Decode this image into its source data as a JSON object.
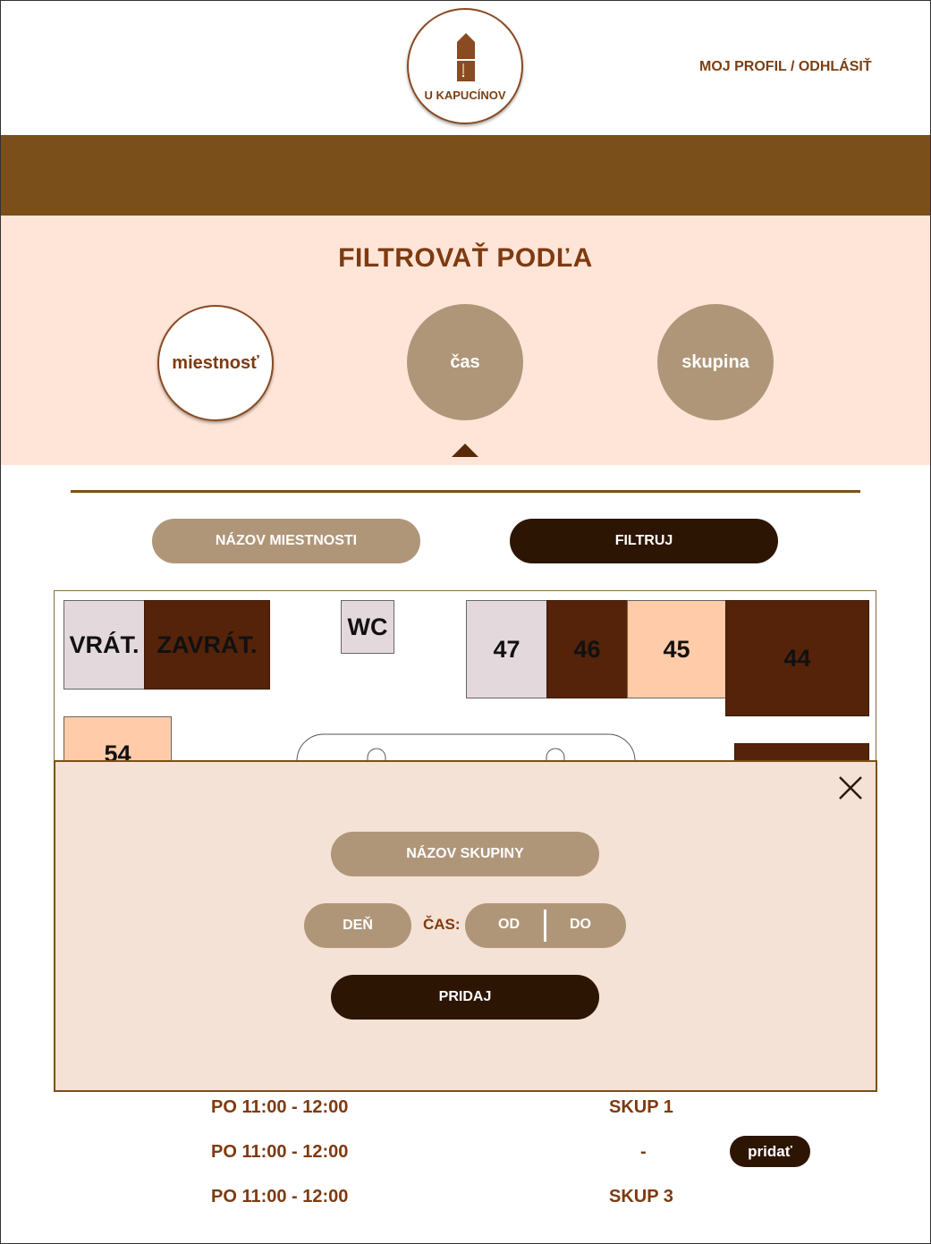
{
  "header": {
    "logo_text": "U KAPUCÍNOV",
    "profile_link": "MOJ PROFIL / ODHLÁSIŤ"
  },
  "filter": {
    "title": "FILTROVAŤ PODĽA",
    "options": [
      {
        "label": "miestnosť",
        "active": true
      },
      {
        "label": "čas",
        "active": false
      },
      {
        "label": "skupina",
        "active": false
      }
    ]
  },
  "controls": {
    "room_name": "NÁZOV MIESTNOSTI",
    "filter_button": "FILTRUJ"
  },
  "map": {
    "rooms": [
      {
        "label": "VRÁT.",
        "style": "grey"
      },
      {
        "label": "ZAVRÁT.",
        "style": "dark"
      },
      {
        "label": "WC",
        "style": "grey"
      },
      {
        "label": "47",
        "style": "grey"
      },
      {
        "label": "46",
        "style": "dark"
      },
      {
        "label": "45",
        "style": "peach"
      },
      {
        "label": "44",
        "style": "dark"
      },
      {
        "label": "54",
        "style": "peach"
      }
    ]
  },
  "modal": {
    "group_name": "NÁZOV SKUPINY",
    "day": "DEŇ",
    "time_label": "ČAS:",
    "from": "OD",
    "to": "DO",
    "add_button": "PRIDAJ"
  },
  "schedule": [
    {
      "time": "PO 11:00 - 12:00",
      "group": "SKUP 1"
    },
    {
      "time": "PO 11:00 - 12:00",
      "group": "-",
      "action": "pridať"
    },
    {
      "time": "PO 11:00 - 12:00",
      "group": "SKUP 3"
    }
  ],
  "colors": {
    "brand_brown": "#7a4f19",
    "accent_text": "#7e3a10",
    "panel_bg": "#fee5d8",
    "pill_light": "#b09679",
    "pill_dark": "#2d1504"
  }
}
